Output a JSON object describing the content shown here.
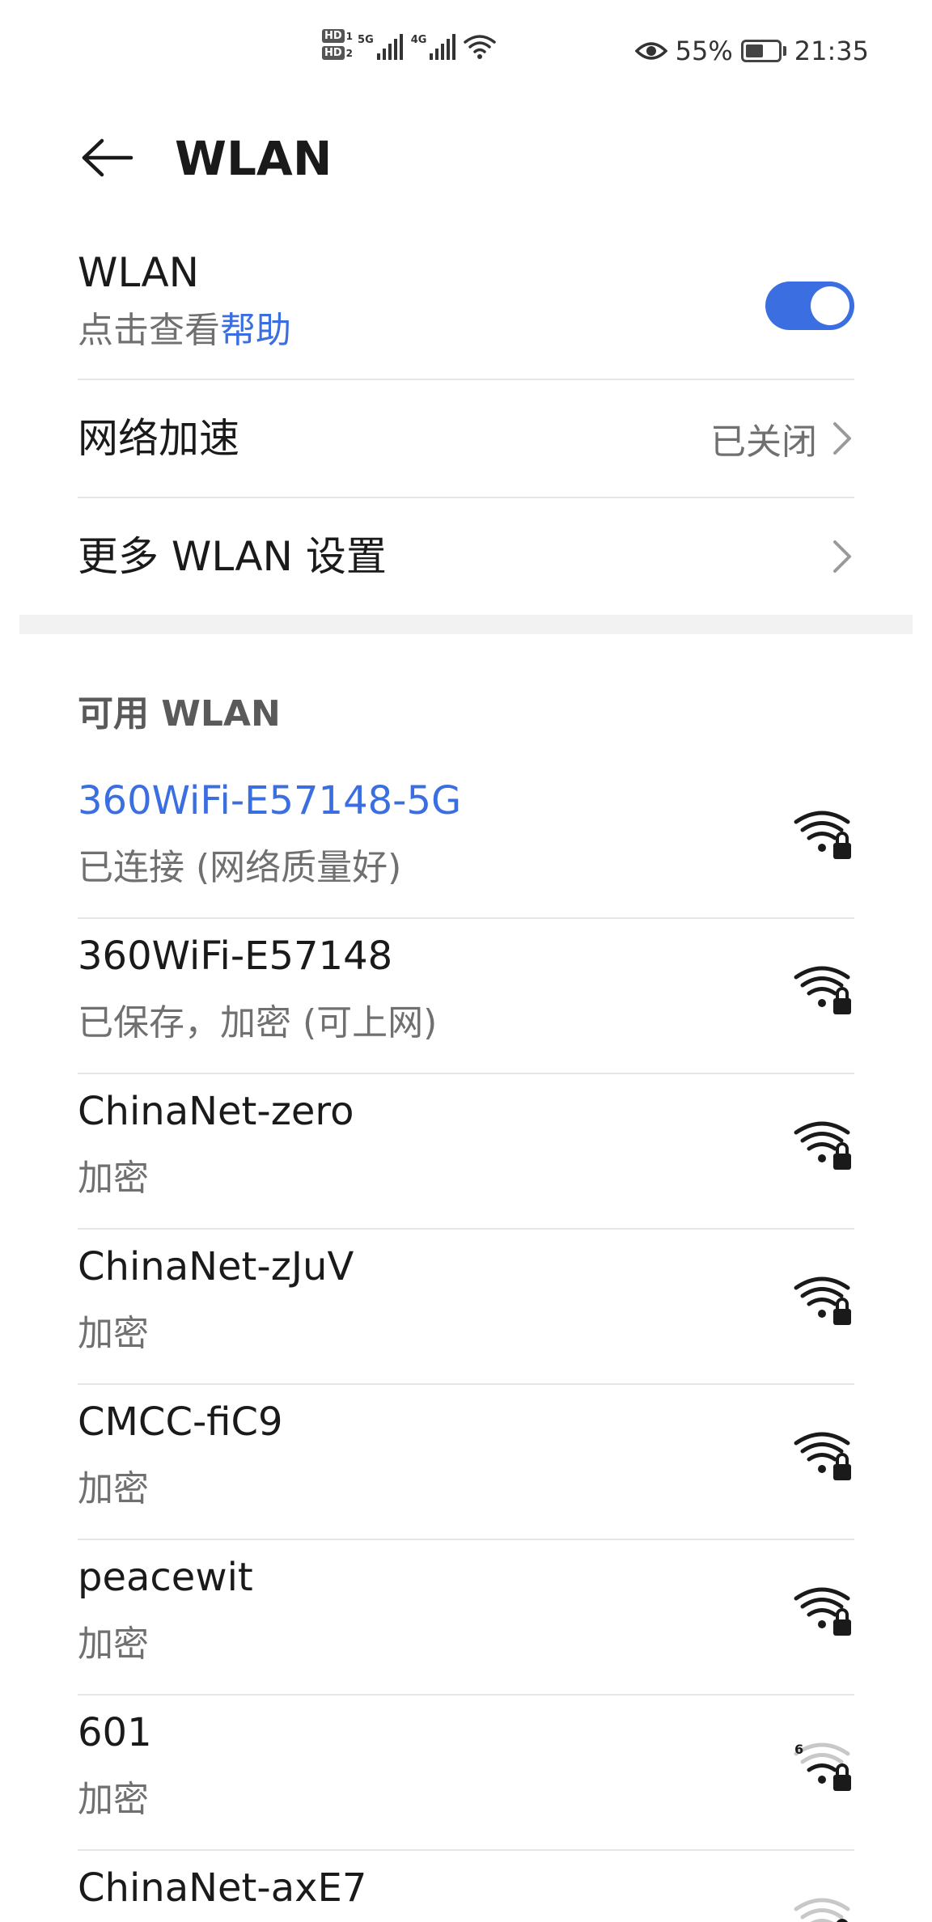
{
  "status_bar": {
    "sim1": "HD",
    "sim1_num": "1",
    "sim2": "HD",
    "sim2_num": "2",
    "net1": "5G",
    "net2": "4G",
    "battery_percent": "55%",
    "battery_level": 0.55,
    "time": "21:35"
  },
  "header": {
    "title": "WLAN"
  },
  "wlan_toggle": {
    "title": "WLAN",
    "hint_prefix": "点击查看",
    "hint_link": "帮助",
    "enabled": true
  },
  "acceleration": {
    "label": "网络加速",
    "value": "已关闭"
  },
  "more_settings": {
    "label": "更多 WLAN 设置"
  },
  "available_header": "可用 WLAN",
  "networks": [
    {
      "name": "360WiFi-E57148-5G",
      "status": "已连接 (网络质量好)",
      "connected": true,
      "signal": 4,
      "secured": true,
      "badge": ""
    },
    {
      "name": "360WiFi-E57148",
      "status": "已保存，加密 (可上网)",
      "connected": false,
      "signal": 4,
      "secured": true,
      "badge": ""
    },
    {
      "name": "ChinaNet-zero",
      "status": "加密",
      "connected": false,
      "signal": 4,
      "secured": true,
      "badge": ""
    },
    {
      "name": "ChinaNet-zJuV",
      "status": "加密",
      "connected": false,
      "signal": 4,
      "secured": true,
      "badge": ""
    },
    {
      "name": "CMCC-fiC9",
      "status": "加密",
      "connected": false,
      "signal": 4,
      "secured": true,
      "badge": ""
    },
    {
      "name": "peacewit",
      "status": "加密",
      "connected": false,
      "signal": 4,
      "secured": true,
      "badge": ""
    },
    {
      "name": "601",
      "status": "加密",
      "connected": false,
      "signal": 2,
      "secured": true,
      "badge": "6"
    },
    {
      "name": "ChinaNet-axE7",
      "status": "",
      "connected": false,
      "signal": 1,
      "secured": true,
      "badge": ""
    }
  ],
  "colors": {
    "accent": "#3b6ee0",
    "text": "#1a1a1a",
    "secondary": "#707070"
  }
}
